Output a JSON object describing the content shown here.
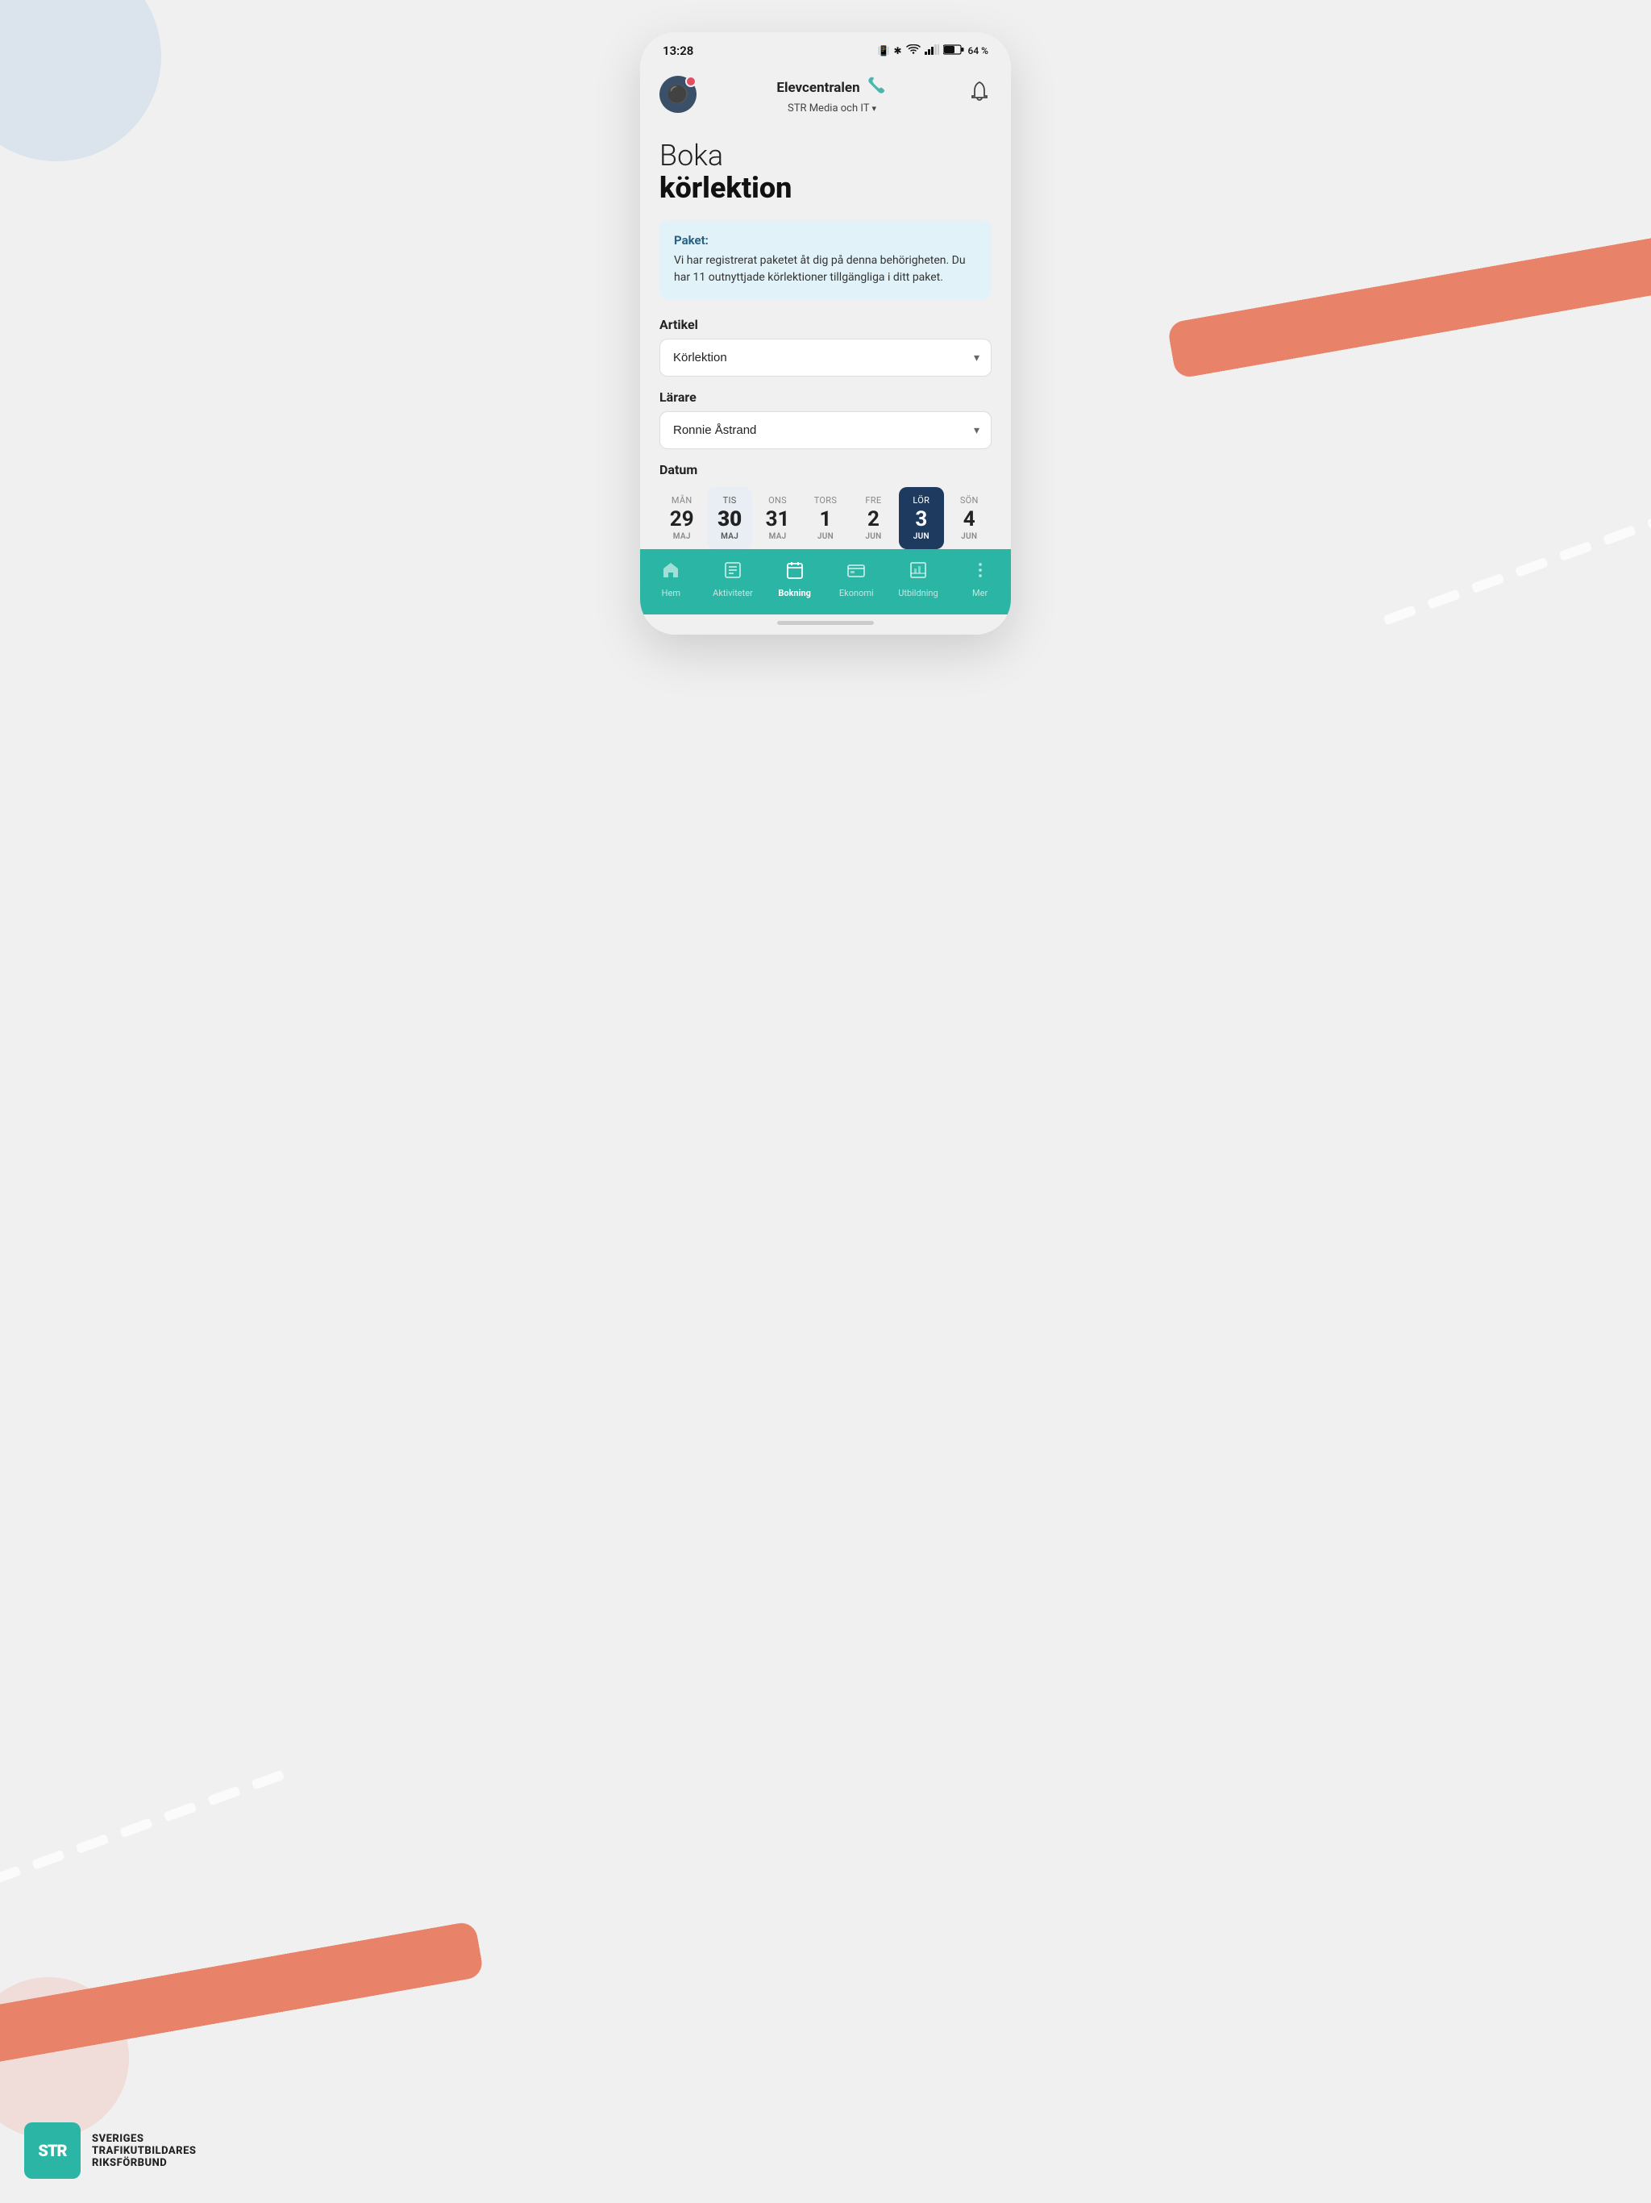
{
  "page": {
    "background": "#f0f0f0"
  },
  "status_bar": {
    "time": "13:28",
    "battery": "64 %"
  },
  "top_nav": {
    "brand": "Elevcentralen",
    "subtitle": "STR Media och IT",
    "subtitle_arrow": "∨"
  },
  "page_title": {
    "line1": "Boka",
    "line2": "körlektion"
  },
  "info_box": {
    "title": "Paket:",
    "text": "Vi har registrerat paketet åt dig på denna behörigheten. Du har 11 outnyttjade körlektioner tillgängliga i ditt paket."
  },
  "form": {
    "artikel_label": "Artikel",
    "artikel_value": "Körlektion",
    "larare_label": "Lärare",
    "larare_value": "Ronnie Åstrand",
    "datum_label": "Datum"
  },
  "dates": [
    {
      "day": "MÅN",
      "number": "29",
      "month": "MAJ",
      "state": "normal"
    },
    {
      "day": "TIS",
      "number": "30",
      "month": "MAJ",
      "state": "today"
    },
    {
      "day": "ONS",
      "number": "31",
      "month": "MAJ",
      "state": "normal"
    },
    {
      "day": "TORS",
      "number": "1",
      "month": "JUN",
      "state": "normal"
    },
    {
      "day": "FRE",
      "number": "2",
      "month": "JUN",
      "state": "normal"
    },
    {
      "day": "LÖR",
      "number": "3",
      "month": "JUN",
      "state": "selected"
    },
    {
      "day": "SÖN",
      "number": "4",
      "month": "JUN",
      "state": "normal"
    }
  ],
  "bottom_nav": {
    "items": [
      {
        "label": "Hem",
        "icon": "⌂",
        "active": false
      },
      {
        "label": "Aktiviteter",
        "icon": "☰",
        "active": false
      },
      {
        "label": "Bokning",
        "icon": "📅",
        "active": true
      },
      {
        "label": "Ekonomi",
        "icon": "💳",
        "active": false
      },
      {
        "label": "Utbildning",
        "icon": "📊",
        "active": false
      },
      {
        "label": "Mer",
        "icon": "⋮",
        "active": false
      }
    ]
  },
  "str_logo": {
    "abbr": "STR",
    "line1": "SVERIGES",
    "line2": "TRAFIKUTBILDARES",
    "line3": "RIKSFÖRBUND"
  }
}
